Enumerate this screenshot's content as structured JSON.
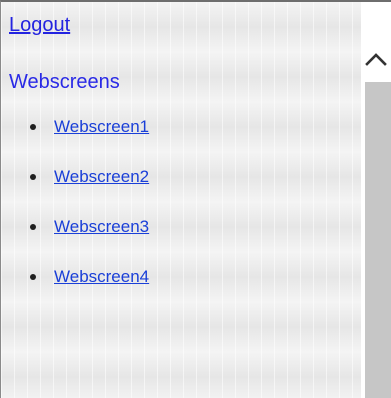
{
  "nav": {
    "logout_label": "Logout",
    "section_title": "Webscreens",
    "items": [
      {
        "label": "Webscreen1"
      },
      {
        "label": "Webscreen2"
      },
      {
        "label": "Webscreen3"
      },
      {
        "label": "Webscreen4"
      }
    ]
  },
  "scrollbar": {
    "up_icon": "chevron-up-icon"
  }
}
